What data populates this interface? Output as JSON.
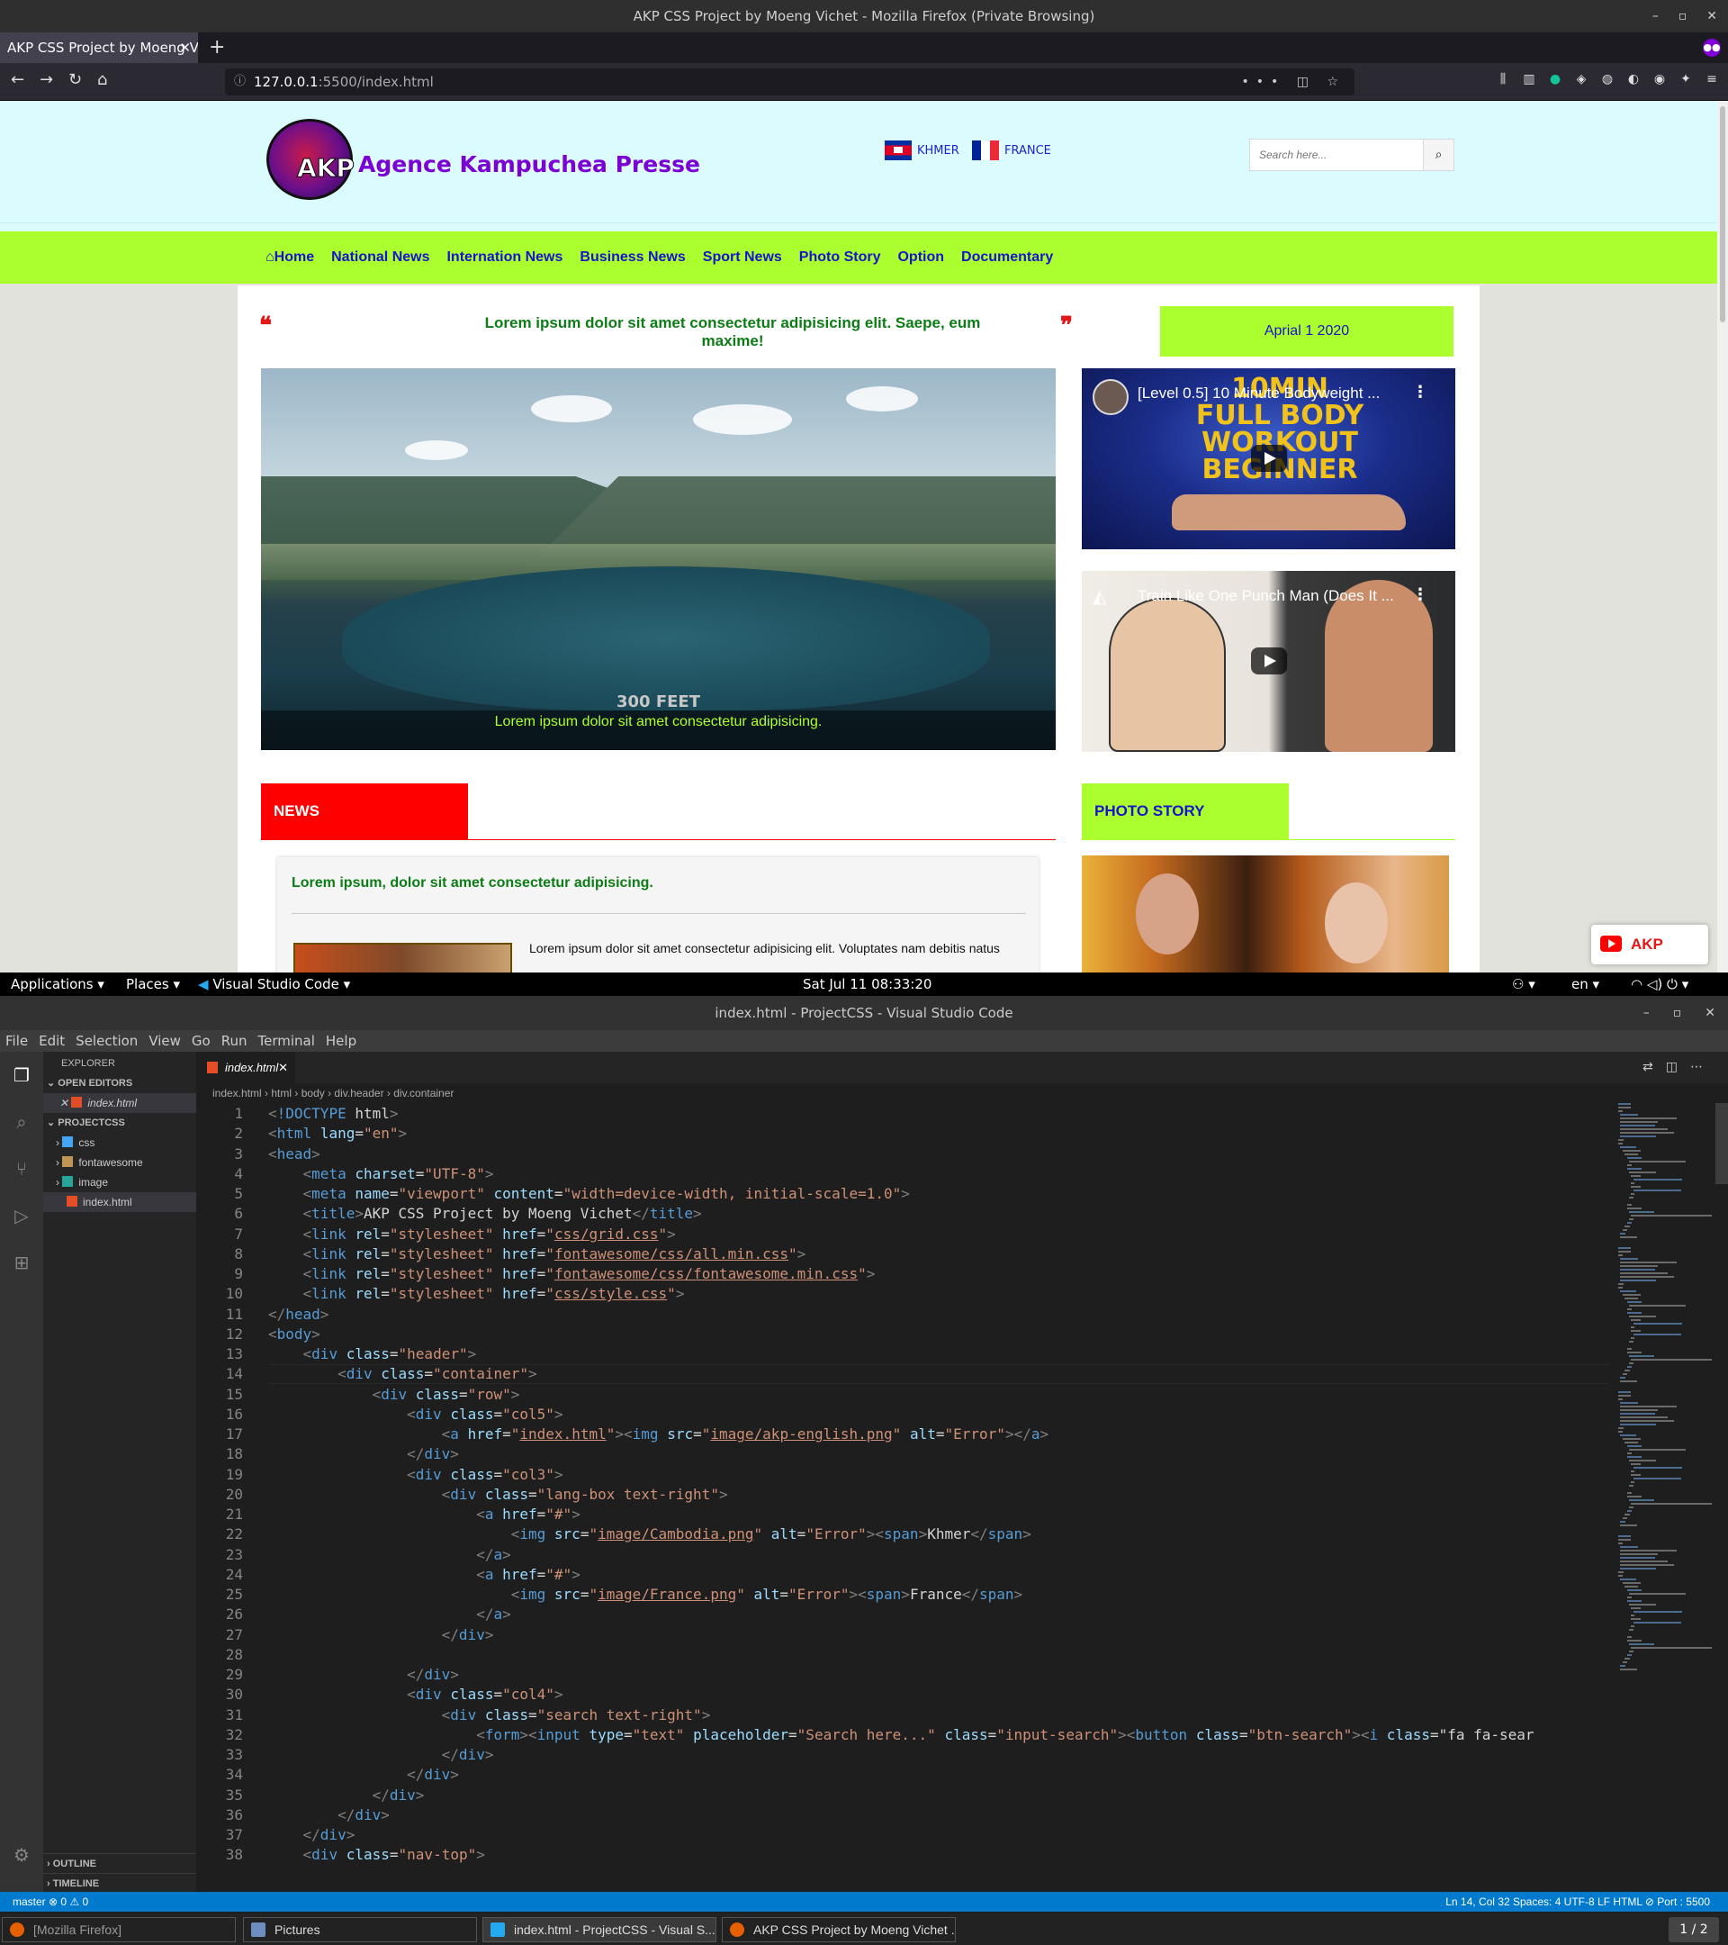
{
  "firefox": {
    "window_title": "AKP CSS Project by Moeng Vichet - Mozilla Firefox (Private Browsing)",
    "tab_title": "AKP CSS Project by Moeng V",
    "url_host": "127.0.0.1",
    "url_rest": ":5500/index.html",
    "private_icon": "mask-icon"
  },
  "site": {
    "logo_abbr": "AKP",
    "logo_name": "Agence Kampuchea Presse",
    "languages": [
      {
        "label": "KHMER",
        "flag": "cambodia-flag"
      },
      {
        "label": "FRANCE",
        "flag": "france-flag"
      }
    ],
    "search_placeholder": "Search here...",
    "nav": [
      "Home",
      "National News",
      "Internation News",
      "Business News",
      "Sport News",
      "Photo Story",
      "Option",
      "Documentary"
    ],
    "headline": "Lorem ipsum dolor sit amet consectetur adipisicing elit. Saepe, eum maxime!",
    "date": "Aprial 1 2020",
    "hero_overlay": "300 FEET",
    "hero_caption": "Lorem ipsum dolor sit amet consectetur adipisicing.",
    "videos": [
      {
        "title": "[Level 0.5] 10 Minute Bodyweight ...",
        "thumb_text": "10MIN FULL BODY WORKOUT BEGINNER"
      },
      {
        "title": "Train Like One Punch Man (Does It ..."
      }
    ],
    "news_label": "NEWS",
    "photo_label": "PHOTO STORY",
    "news_title": "Lorem ipsum, dolor sit amet consectetur adipisicing.",
    "news_text": "Lorem ipsum dolor sit amet consectetur adipisicing elit. Voluptates nam debitis natus",
    "video_button": "AKP Video",
    "colors": {
      "accent_green": "#acff2f",
      "nav_blue": "#1714c9",
      "news_red": "#ff0000",
      "header_bg": "#dbfbff"
    }
  },
  "gnome": {
    "applications": "Applications",
    "places": "Places",
    "active_app": "Visual Studio Code",
    "clock": "Sat Jul 11  08:33:20",
    "lang": "en"
  },
  "vscode": {
    "title": "index.html - ProjectCSS - Visual Studio Code",
    "menu": [
      "File",
      "Edit",
      "Selection",
      "View",
      "Go",
      "Run",
      "Terminal",
      "Help"
    ],
    "explorer_title": "EXPLORER",
    "open_editors": "OPEN EDITORS",
    "open_file": "index.html",
    "project": "PROJECTCSS",
    "tree": [
      "css",
      "fontawesome",
      "image",
      "index.html"
    ],
    "outline": "OUTLINE",
    "timeline": "TIMELINE",
    "tab": "index.html",
    "breadcrumb": [
      "index.html",
      "html",
      "body",
      "div.header",
      "div.container"
    ],
    "status_left": "master   ⊗ 0  ⚠ 0",
    "status_right": "Ln 14, Col 32    Spaces: 4    UTF-8    LF    HTML    ⊘ Port : 5500",
    "code_lines": [
      "<!DOCTYPE html>",
      "<html lang=\"en\">",
      "<head>",
      "    <meta charset=\"UTF-8\">",
      "    <meta name=\"viewport\" content=\"width=device-width, initial-scale=1.0\">",
      "    <title>AKP CSS Project by Moeng Vichet</title>",
      "    <link rel=\"stylesheet\" href=\"css/grid.css\">",
      "    <link rel=\"stylesheet\" href=\"fontawesome/css/all.min.css\">",
      "    <link rel=\"stylesheet\" href=\"fontawesome/css/fontawesome.min.css\">",
      "    <link rel=\"stylesheet\" href=\"css/style.css\">",
      "</head>",
      "<body>",
      "    <div class=\"header\">",
      "        <div class=\"container\">",
      "            <div class=\"row\">",
      "                <div class=\"col5\">",
      "                    <a href=\"index.html\"><img src=\"image/akp-english.png\" alt=\"Error\"></a>",
      "                </div>",
      "                <div class=\"col3\">",
      "                    <div class=\"lang-box text-right\">",
      "                        <a href=\"#\">",
      "                            <img src=\"image/Cambodia.png\" alt=\"Error\"><span>Khmer</span>",
      "                        </a>",
      "                        <a href=\"#\">",
      "                            <img src=\"image/France.png\" alt=\"Error\"><span>France</span>",
      "                        </a>",
      "                    </div>",
      "",
      "                </div>",
      "                <div class=\"col4\">",
      "                    <div class=\"search text-right\">",
      "                        <form><input type=\"text\" placeholder=\"Search here...\" class=\"input-search\"><button class=\"btn-search\"><i class=\"fa fa-sear",
      "                    </div>",
      "                </div>",
      "            </div>",
      "        </div>",
      "    </div>",
      "    <div class=\"nav-top\">"
    ]
  },
  "taskbar": {
    "items": [
      "[Mozilla Firefox]",
      "Pictures",
      "index.html - ProjectCSS - Visual S...",
      "AKP CSS Project by Moeng Vichet ..."
    ],
    "workspace": "1 / 2"
  }
}
